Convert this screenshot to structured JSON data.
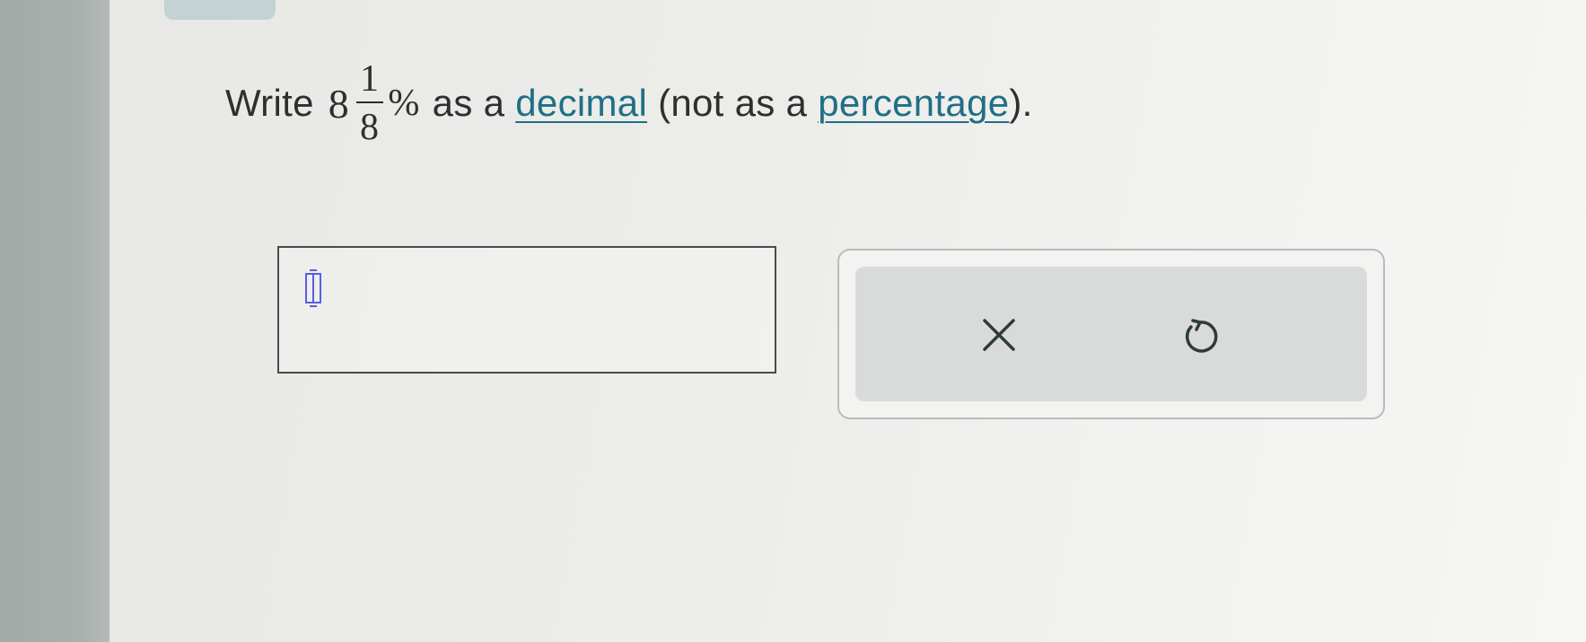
{
  "question": {
    "prefix": "Write",
    "mixed_number": {
      "whole": "8",
      "numerator": "1",
      "denominator": "8"
    },
    "percent_sign": "%",
    "middle": "as a",
    "link_decimal": "decimal",
    "paren_open": "(not as a",
    "link_percentage": "percentage",
    "paren_close": ")."
  },
  "answer": {
    "value": ""
  },
  "tools": {
    "clear_icon": "x-icon",
    "undo_icon": "undo-icon"
  },
  "colors": {
    "link": "#1f6f86",
    "cursor": "#5a5ee0",
    "tool_panel_bg": "#d8dbd9"
  }
}
